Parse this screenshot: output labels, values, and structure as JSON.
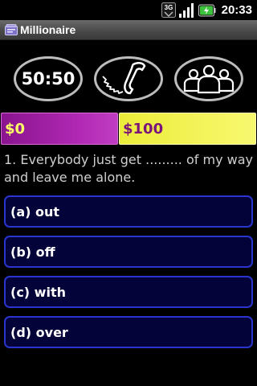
{
  "status_bar": {
    "network_badge": "3G",
    "time": "20:33"
  },
  "app": {
    "title": "Millionaire"
  },
  "lifelines": {
    "fifty_fifty_label": "50:50",
    "phone_icon": "phone-handset-icon",
    "audience_icon": "audience-people-icon"
  },
  "prize": {
    "current": "$0",
    "next": "$100"
  },
  "question": {
    "text": "1. Everybody just get ......... of my way and leave me alone."
  },
  "answers": [
    {
      "label": "(a) out"
    },
    {
      "label": "(b) off"
    },
    {
      "label": "(c) with"
    },
    {
      "label": "(d) over"
    }
  ],
  "colors": {
    "prize_current": "#b22ab5",
    "prize_next": "#f0f04a",
    "answer_bg": "#03033a",
    "answer_border": "#2a34cf"
  }
}
